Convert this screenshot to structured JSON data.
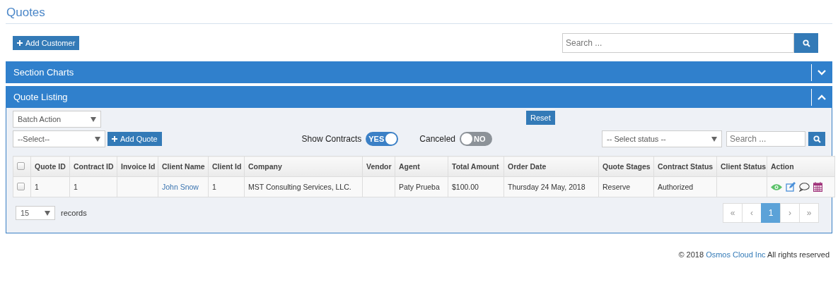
{
  "page": {
    "title": "Quotes"
  },
  "toolbar": {
    "add_button": "Add Customer",
    "search": {
      "placeholder": "Search ..."
    }
  },
  "sections": [
    {
      "title": "Section Charts",
      "expanded": false
    },
    {
      "title": "Quote Listing",
      "expanded": true
    }
  ],
  "listing": {
    "batch_action": {
      "value": "Batch Action"
    },
    "select": {
      "value": "--Select--"
    },
    "add_quote": "Add Quote",
    "reset": "Reset",
    "toggles": [
      {
        "label": "Show Contracts",
        "on": true,
        "text": "YES"
      },
      {
        "label": "Canceled",
        "on": false,
        "text": "NO"
      }
    ],
    "status_select": {
      "value": "-- Select status --"
    },
    "search": {
      "placeholder": "Search ..."
    }
  },
  "table": {
    "all_checked": false,
    "columns": [
      "Quote ID",
      "Contract ID",
      "Invoice Id",
      "Client Name",
      "Client Id",
      "Company",
      "Vendor",
      "Agent",
      "Total Amount",
      "Order Date",
      "Quote Stages",
      "Contract Status",
      "Client Status",
      "Action"
    ],
    "rows": [
      {
        "checked": false,
        "cells": [
          "1",
          "1",
          null,
          {
            "text": "John Snow",
            "kind": "link"
          },
          "1",
          "MST Consulting Services, LLC.",
          null,
          "Paty Prueba",
          "$100.00",
          "Thursday 24 May, 2018",
          "Reserve",
          "Authorized",
          null,
          {
            "kind": "actions"
          }
        ]
      }
    ]
  },
  "pagination": {
    "page_size": "15",
    "records_label": "records",
    "pages": [
      {
        "label": "«",
        "selected": false
      },
      {
        "label": "‹",
        "selected": false
      },
      {
        "label": "1",
        "selected": true
      },
      {
        "label": "›",
        "selected": false
      },
      {
        "label": "»",
        "selected": false
      }
    ]
  },
  "footer": {
    "prefix": "© 2018",
    "link": "Osmos Cloud Inc",
    "suffix": "All rights reserved"
  }
}
